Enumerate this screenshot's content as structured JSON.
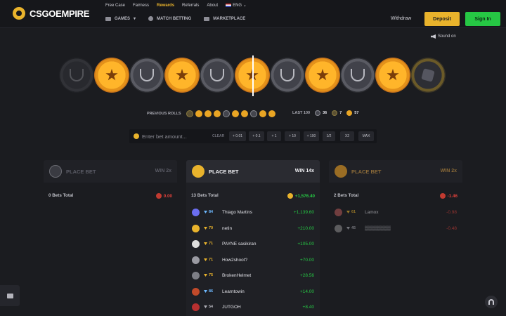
{
  "brand": {
    "name": "CSGOEMPIRE"
  },
  "topnav": {
    "links": [
      "Free Case",
      "Fairness",
      "Rewards",
      "Referrals",
      "About"
    ],
    "language": "ENG"
  },
  "mainnav": {
    "games": "GAMES",
    "match_betting": "MATCH BETTING",
    "marketplace": "MARKETPLACE"
  },
  "auth": {
    "withdraw": "Withdraw",
    "deposit": "Deposit",
    "sign_in": "Sign In"
  },
  "sound": {
    "label": "Sound on"
  },
  "previous_rolls": {
    "label": "PREVIOUS ROLLS",
    "rolls": [
      "bonus",
      "t",
      "t",
      "t",
      "ct",
      "t",
      "t",
      "ct",
      "t",
      "t"
    ]
  },
  "last100": {
    "label": "LAST 100",
    "ct": "36",
    "bonus": "7",
    "t": "57"
  },
  "bet": {
    "placeholder": "Enter bet amount...",
    "clear": "CLEAR",
    "buttons": [
      "+ 0.01",
      "+ 0.1",
      "+ 1",
      "+ 10",
      "+ 100",
      "1/2",
      "X2",
      "MAX"
    ]
  },
  "panels": {
    "ct": {
      "title": "PLACE BET",
      "win": "WIN 2x",
      "total_label": "0 Bets Total",
      "total": "0.00"
    },
    "bonus": {
      "title": "PLACE BET",
      "win": "WIN 14x",
      "total_label": "13 Bets Total",
      "total": "+1,576.40",
      "rows": [
        {
          "name": "Thiago Martins",
          "level": "84",
          "amount": "+1,139.60",
          "level_color": "#6db8ff"
        },
        {
          "name": "netin",
          "level": "70",
          "amount": "+210.00",
          "level_color": "#e9b32c"
        },
        {
          "name": "PAYNE sasikiran",
          "level": "71",
          "amount": "+105.00",
          "level_color": "#e9b32c"
        },
        {
          "name": "How2shoot?",
          "level": "71",
          "amount": "+70.00",
          "level_color": "#e9b32c"
        },
        {
          "name": "BrokenHelmet",
          "level": "75",
          "amount": "+28.56",
          "level_color": "#e9b32c"
        },
        {
          "name": "Learntowin",
          "level": "86",
          "amount": "+14.00",
          "level_color": "#6db8ff"
        },
        {
          "name": "JUTGOH",
          "level": "54",
          "amount": "+8.40",
          "level_color": "#b0b0b8"
        }
      ]
    },
    "t": {
      "title": "PLACE BET",
      "win": "WIN 2x",
      "total_label": "2 Bets Total",
      "total": "-1.46",
      "rows": [
        {
          "name": "Lamox",
          "level": "61",
          "amount": "-0.98",
          "level_color": "#e9b32c"
        },
        {
          "name": "▒▒▒▒▒▒▒▒",
          "level": "45",
          "amount": "-0.48",
          "level_color": "#b0b0b8"
        }
      ]
    }
  },
  "colors": {
    "accent": "#e9b32c",
    "green": "#26c744",
    "red": "#e0413a",
    "background": "#1b1c20"
  }
}
